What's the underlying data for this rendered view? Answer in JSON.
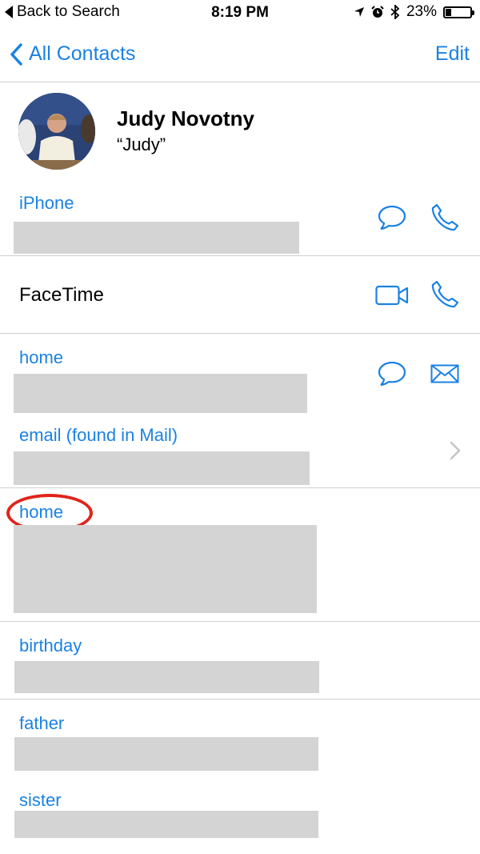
{
  "status_bar": {
    "back_label": "Back to Search",
    "time": "8:19 PM",
    "battery_text": "23%",
    "battery_level": 0.23,
    "icons": [
      "location-arrow-icon",
      "alarm-icon",
      "bluetooth-icon",
      "battery-icon"
    ]
  },
  "nav": {
    "back_label": "All Contacts",
    "edit_label": "Edit"
  },
  "contact": {
    "name": "Judy Novotny",
    "nickname": "“Judy”"
  },
  "fields": {
    "phone_label": "iPhone",
    "facetime_label": "FaceTime",
    "home_email_label": "home",
    "found_email_label": "email (found in Mail)",
    "home_address_label": "home",
    "birthday_label": "birthday",
    "father_label": "father",
    "sister_label": "sister"
  },
  "colors": {
    "accent": "#1a82e2",
    "highlight": "#e0241b",
    "redaction": "#d4d4d4"
  }
}
